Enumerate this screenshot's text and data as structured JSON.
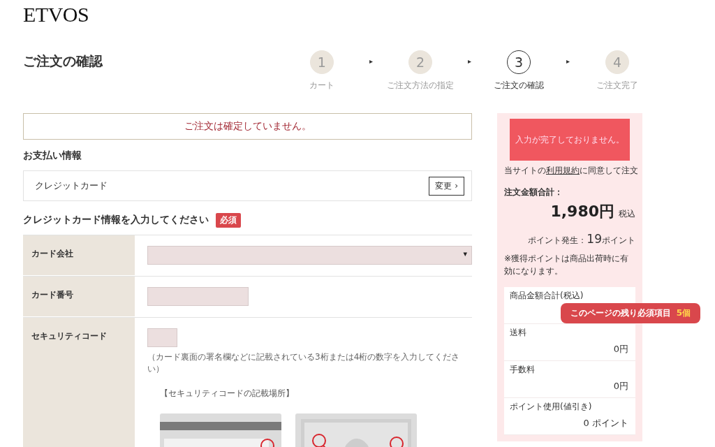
{
  "logo": "ETVOS",
  "page_title": "ご注文の確認",
  "steps": [
    {
      "number": "1",
      "label": "カート",
      "selected": false
    },
    {
      "number": "2",
      "label": "ご注文方法の指定",
      "selected": false
    },
    {
      "number": "3",
      "label": "ご注文の確認",
      "selected": true
    },
    {
      "number": "4",
      "label": "ご注文完了",
      "selected": false
    }
  ],
  "step_separator": "▸",
  "notice": "ご注文は確定していません。",
  "payment": {
    "heading": "お支払い情報",
    "method": "クレジットカード",
    "change_button": "変更 ›"
  },
  "card_form": {
    "heading": "クレジットカード情報を入力してください",
    "required_badge": "必須",
    "rows": [
      {
        "kind": "select",
        "label": "カード会社",
        "caret": "▾"
      },
      {
        "kind": "text",
        "label": "カード番号"
      },
      {
        "kind": "code",
        "label": "セキュリティコード",
        "hint": "（カード裏面の署名欄などに記載されている3桁または4桁の数字を入力してください）",
        "diagram_title": "【セキュリティコードの記載場所】"
      }
    ]
  },
  "summary": {
    "submit_button": "入力が完了しておりません。",
    "terms_before": "当サイトの",
    "terms_link": "利用規約",
    "terms_after": "に同意して注文",
    "total_label": "注文金額合計：",
    "total_amount": "1,980円",
    "tax_note": "税込",
    "points_label": "ポイント発生：",
    "points_value": "19",
    "points_unit": "ポイント",
    "points_note": "※獲得ポイントは商品出荷時に有効になります。",
    "lines": [
      {
        "label": "商品金額合計(税込)"
      },
      {
        "label": "送料",
        "value": "0円"
      },
      {
        "label": "手数料",
        "value": "0円"
      },
      {
        "label": "ポイント使用(値引き)",
        "value": "0 ポイント"
      }
    ]
  },
  "remaining_badge": {
    "text": "このページの残り必須項目",
    "count": "5個"
  }
}
